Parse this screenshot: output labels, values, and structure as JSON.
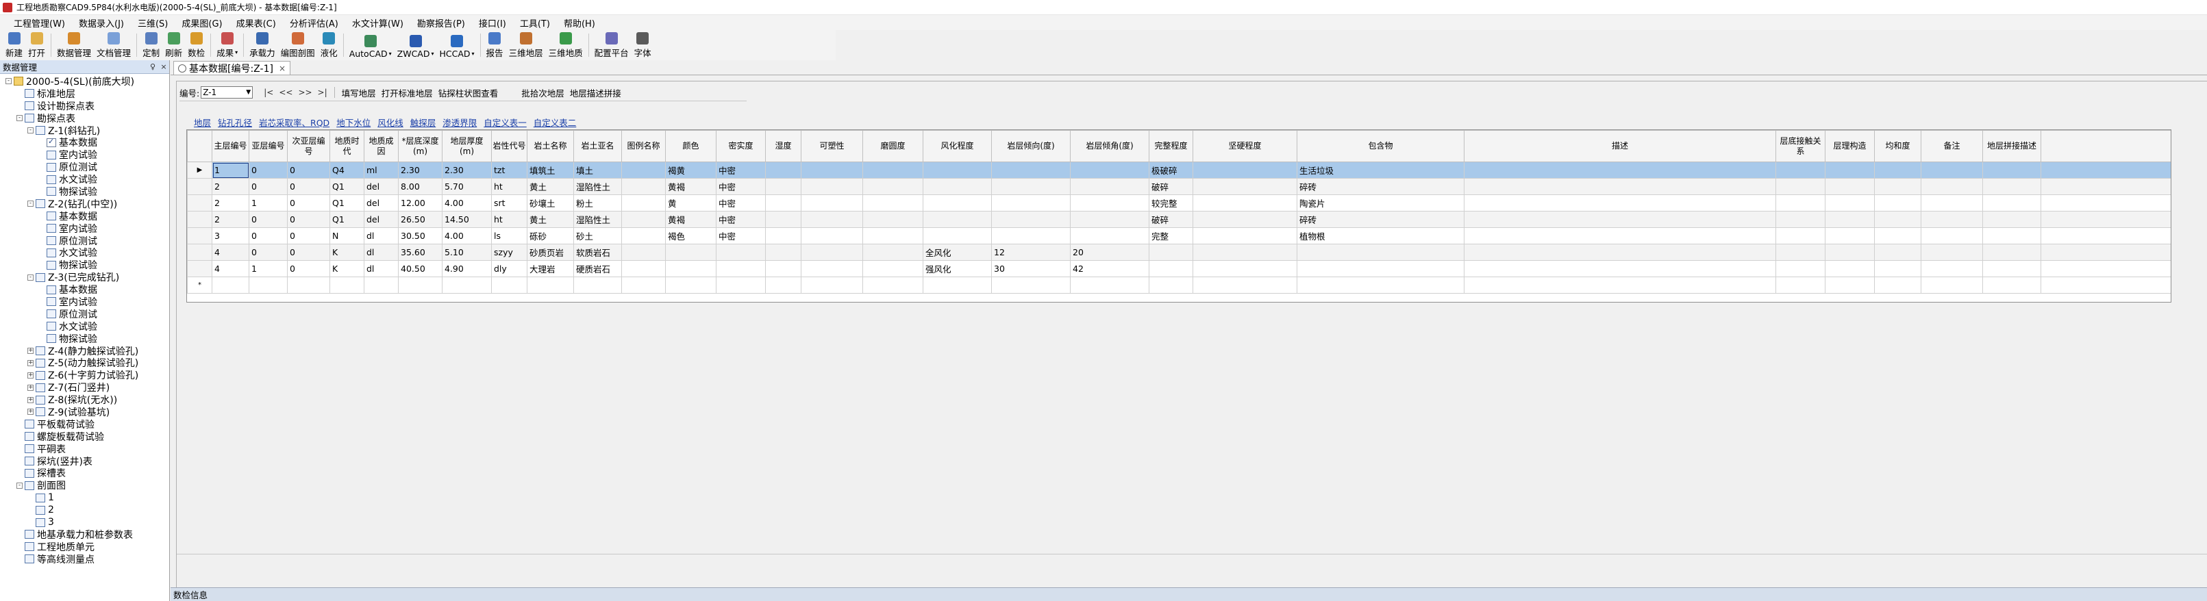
{
  "window": {
    "title": "工程地质勘察CAD9.5P84(水利水电版)(2000-5-4(SL)_前底大坝) - 基本数据[编号:Z-1]"
  },
  "menubar": {
    "items": [
      "工程管理(W)",
      "数据录入(J)",
      "三维(S)",
      "成果图(G)",
      "成果表(C)",
      "分析评估(A)",
      "水文计算(W)",
      "勘察报告(P)",
      "接口(I)",
      "工具(T)",
      "帮助(H)"
    ]
  },
  "toolbar": {
    "buttons": [
      {
        "label": "新建",
        "icon": "new-file-icon",
        "color": "#4a78c2"
      },
      {
        "label": "打开",
        "icon": "open-folder-icon",
        "color": "#e0b04a"
      },
      {
        "label": "数据管理",
        "icon": "data-manage-icon",
        "color": "#d68a2c"
      },
      {
        "label": "文档管理",
        "icon": "document-manage-icon",
        "color": "#7aa0d8"
      },
      {
        "label": "定制",
        "icon": "customize-icon",
        "color": "#5a7fbf"
      },
      {
        "label": "刷新",
        "icon": "refresh-icon",
        "color": "#4a9e5c"
      },
      {
        "label": "数检",
        "icon": "data-check-icon",
        "color": "#d89a2a"
      },
      {
        "label": "成果",
        "icon": "results-icon",
        "color": "#c85050",
        "dropdown": true
      },
      {
        "label": "承载力",
        "icon": "bearing-capacity-icon",
        "color": "#3a6ab0"
      },
      {
        "label": "编图剖图",
        "icon": "section-drawing-icon",
        "color": "#d06a3a"
      },
      {
        "label": "液化",
        "icon": "liquefaction-icon",
        "color": "#2a8ab8"
      },
      {
        "label": "AutoCAD",
        "icon": "autocad-icon",
        "color": "#3c8a5a",
        "dropdown": true
      },
      {
        "label": "ZWCAD",
        "icon": "zwcad-icon",
        "color": "#2a5ab0",
        "dropdown": true
      },
      {
        "label": "HCCAD",
        "icon": "hccad-icon",
        "color": "#2a6ac0",
        "dropdown": true
      },
      {
        "label": "报告",
        "icon": "report-icon",
        "color": "#4a7ac8"
      },
      {
        "label": "三维地层",
        "icon": "3d-strata-icon",
        "color": "#c07030"
      },
      {
        "label": "三维地质",
        "icon": "3d-geology-icon",
        "color": "#3a9a4a"
      },
      {
        "label": "配置平台",
        "icon": "config-platform-icon",
        "color": "#6a6ab8"
      },
      {
        "label": "字体",
        "icon": "font-icon",
        "color": "#5a5a5a"
      }
    ]
  },
  "left_panel": {
    "title": "数据管理",
    "pin": "♀",
    "close": "×",
    "tree": [
      {
        "label": "2000-5-4(SL)(前底大坝)",
        "level": 0,
        "exp": "-",
        "icon": "database-icon"
      },
      {
        "label": "标准地层",
        "level": 1,
        "exp": "",
        "icon": "table-icon"
      },
      {
        "label": "设计勘探点表",
        "level": 1,
        "exp": "",
        "icon": "table-icon"
      },
      {
        "label": "勘探点表",
        "level": 1,
        "exp": "-",
        "icon": "table-icon"
      },
      {
        "label": "Z-1(斜钻孔)",
        "level": 2,
        "exp": "-",
        "icon": "table-icon"
      },
      {
        "label": "基本数据",
        "level": 3,
        "exp": "",
        "icon": "checked-table-icon"
      },
      {
        "label": "室内试验",
        "level": 3,
        "exp": "",
        "icon": "table-icon"
      },
      {
        "label": "原位测试",
        "level": 3,
        "exp": "",
        "icon": "table-icon"
      },
      {
        "label": "水文试验",
        "level": 3,
        "exp": "",
        "icon": "table-icon"
      },
      {
        "label": "物探试验",
        "level": 3,
        "exp": "",
        "icon": "table-icon"
      },
      {
        "label": "Z-2(钻孔(中空))",
        "level": 2,
        "exp": "-",
        "icon": "table-icon"
      },
      {
        "label": "基本数据",
        "level": 3,
        "exp": "",
        "icon": "table-icon"
      },
      {
        "label": "室内试验",
        "level": 3,
        "exp": "",
        "icon": "table-icon"
      },
      {
        "label": "原位测试",
        "level": 3,
        "exp": "",
        "icon": "table-icon"
      },
      {
        "label": "水文试验",
        "level": 3,
        "exp": "",
        "icon": "table-icon"
      },
      {
        "label": "物探试验",
        "level": 3,
        "exp": "",
        "icon": "table-icon"
      },
      {
        "label": "Z-3(已完成钻孔)",
        "level": 2,
        "exp": "-",
        "icon": "table-icon"
      },
      {
        "label": "基本数据",
        "level": 3,
        "exp": "",
        "icon": "table-icon"
      },
      {
        "label": "室内试验",
        "level": 3,
        "exp": "",
        "icon": "table-icon"
      },
      {
        "label": "原位测试",
        "level": 3,
        "exp": "",
        "icon": "table-icon"
      },
      {
        "label": "水文试验",
        "level": 3,
        "exp": "",
        "icon": "table-icon"
      },
      {
        "label": "物探试验",
        "level": 3,
        "exp": "",
        "icon": "table-icon"
      },
      {
        "label": "Z-4(静力触探试验孔)",
        "level": 2,
        "exp": "+",
        "icon": "table-icon"
      },
      {
        "label": "Z-5(动力触探试验孔)",
        "level": 2,
        "exp": "+",
        "icon": "table-icon"
      },
      {
        "label": "Z-6(十字剪力试验孔)",
        "level": 2,
        "exp": "+",
        "icon": "table-icon"
      },
      {
        "label": "Z-7(石门竖井)",
        "level": 2,
        "exp": "+",
        "icon": "table-icon"
      },
      {
        "label": "Z-8(探坑(无水))",
        "level": 2,
        "exp": "+",
        "icon": "table-icon"
      },
      {
        "label": "Z-9(试验基坑)",
        "level": 2,
        "exp": "+",
        "icon": "table-icon"
      },
      {
        "label": "平板载荷试验",
        "level": 1,
        "exp": "",
        "icon": "table-icon"
      },
      {
        "label": "螺旋板载荷试验",
        "level": 1,
        "exp": "",
        "icon": "table-icon"
      },
      {
        "label": "平硐表",
        "level": 1,
        "exp": "",
        "icon": "table-icon"
      },
      {
        "label": "探坑(竖井)表",
        "level": 1,
        "exp": "",
        "icon": "table-icon"
      },
      {
        "label": "探槽表",
        "level": 1,
        "exp": "",
        "icon": "table-icon"
      },
      {
        "label": "剖面图",
        "level": 1,
        "exp": "-",
        "icon": "table-icon"
      },
      {
        "label": "1",
        "level": 2,
        "exp": "",
        "icon": "table-icon"
      },
      {
        "label": "2",
        "level": 2,
        "exp": "",
        "icon": "table-icon"
      },
      {
        "label": "3",
        "level": 2,
        "exp": "",
        "icon": "table-icon"
      },
      {
        "label": "地基承载力和桩参数表",
        "level": 1,
        "exp": "",
        "icon": "table-icon"
      },
      {
        "label": "工程地质单元",
        "level": 1,
        "exp": "",
        "icon": "table-icon"
      },
      {
        "label": "等高线测量点",
        "level": 1,
        "exp": "",
        "icon": "table-icon"
      }
    ]
  },
  "document": {
    "tab_label": "基本数据[编号:Z-1]",
    "tab_close": "×",
    "nav": {
      "code_label": "编号:",
      "code_value": "Z-1",
      "first": "|<",
      "prev": "<<",
      "next": ">>",
      "last": ">|",
      "buttons": [
        "填写地层",
        "打开标准地层",
        "钻探柱状图查看",
        "批拾次地层",
        "地层描述拼接"
      ]
    },
    "subtabs": [
      "地层",
      "钻孔孔径",
      "岩芯采取率、RQD",
      "地下水位",
      "风化线",
      "触探层",
      "渗透界限",
      "自定义表一",
      "自定义表二"
    ],
    "active_subtab": 0,
    "columns": [
      "主层编号",
      "亚层编号",
      "次亚层编号",
      "地质时代",
      "地质成因",
      "*层底深度(m)",
      "地层厚度(m)",
      "岩性代号",
      "岩土名称",
      "岩土亚名",
      "图例名称",
      "颜色",
      "密实度",
      "湿度",
      "可塑性",
      "磨圆度",
      "风化程度",
      "岩层倾向(度)",
      "岩层倾角(度)",
      "完整程度",
      "坚硬程度",
      "包含物",
      "描述",
      "层底接触关系",
      "层理构造",
      "均和度",
      "备注",
      "地层拼接描述"
    ],
    "rows": [
      [
        "1",
        "0",
        "0",
        "Q4",
        "ml",
        "2.30",
        "2.30",
        "tzt",
        "填筑土",
        "填土",
        "",
        "褐黄",
        "中密",
        "",
        "",
        "",
        "",
        "",
        "",
        "极破碎",
        "",
        "生活垃圾",
        "",
        "",
        "",
        "",
        "",
        ""
      ],
      [
        "2",
        "0",
        "0",
        "Q1",
        "del",
        "8.00",
        "5.70",
        "ht",
        "黄土",
        "湿陷性土",
        "",
        "黄褐",
        "中密",
        "",
        "",
        "",
        "",
        "",
        "",
        "破碎",
        "",
        "碎砖",
        "",
        "",
        "",
        "",
        "",
        ""
      ],
      [
        "2",
        "1",
        "0",
        "Q1",
        "del",
        "12.00",
        "4.00",
        "srt",
        "砂壤土",
        "粉土",
        "",
        "黄",
        "中密",
        "",
        "",
        "",
        "",
        "",
        "",
        "较完整",
        "",
        "陶瓷片",
        "",
        "",
        "",
        "",
        "",
        ""
      ],
      [
        "2",
        "0",
        "0",
        "Q1",
        "del",
        "26.50",
        "14.50",
        "ht",
        "黄土",
        "湿陷性土",
        "",
        "黄褐",
        "中密",
        "",
        "",
        "",
        "",
        "",
        "",
        "破碎",
        "",
        "碎砖",
        "",
        "",
        "",
        "",
        "",
        ""
      ],
      [
        "3",
        "0",
        "0",
        "N",
        "dl",
        "30.50",
        "4.00",
        "ls",
        "砾砂",
        "砂土",
        "",
        "褐色",
        "中密",
        "",
        "",
        "",
        "",
        "",
        "",
        "完整",
        "",
        "植物根",
        "",
        "",
        "",
        "",
        "",
        ""
      ],
      [
        "4",
        "0",
        "0",
        "K",
        "dl",
        "35.60",
        "5.10",
        "szyy",
        "砂质页岩",
        "软质岩石",
        "",
        "",
        "",
        "",
        "",
        "",
        "全风化",
        "12",
        "20",
        "",
        "",
        "",
        "",
        "",
        "",
        "",
        "",
        ""
      ],
      [
        "4",
        "1",
        "0",
        "K",
        "dl",
        "40.50",
        "4.90",
        "dly",
        "大理岩",
        "硬质岩石",
        "",
        "",
        "",
        "",
        "",
        "",
        "强风化",
        "30",
        "42",
        "",
        "",
        "",
        "",
        "",
        "",
        "",
        "",
        ""
      ]
    ],
    "row_indicator_current": "▶",
    "row_indicator_new": "*"
  },
  "statusbar": {
    "text": "数检信息"
  },
  "colors": {
    "selected_row": "#a8c9ea",
    "link_tab": "#1a3fa8",
    "panel_header": "#d7e3f3"
  }
}
